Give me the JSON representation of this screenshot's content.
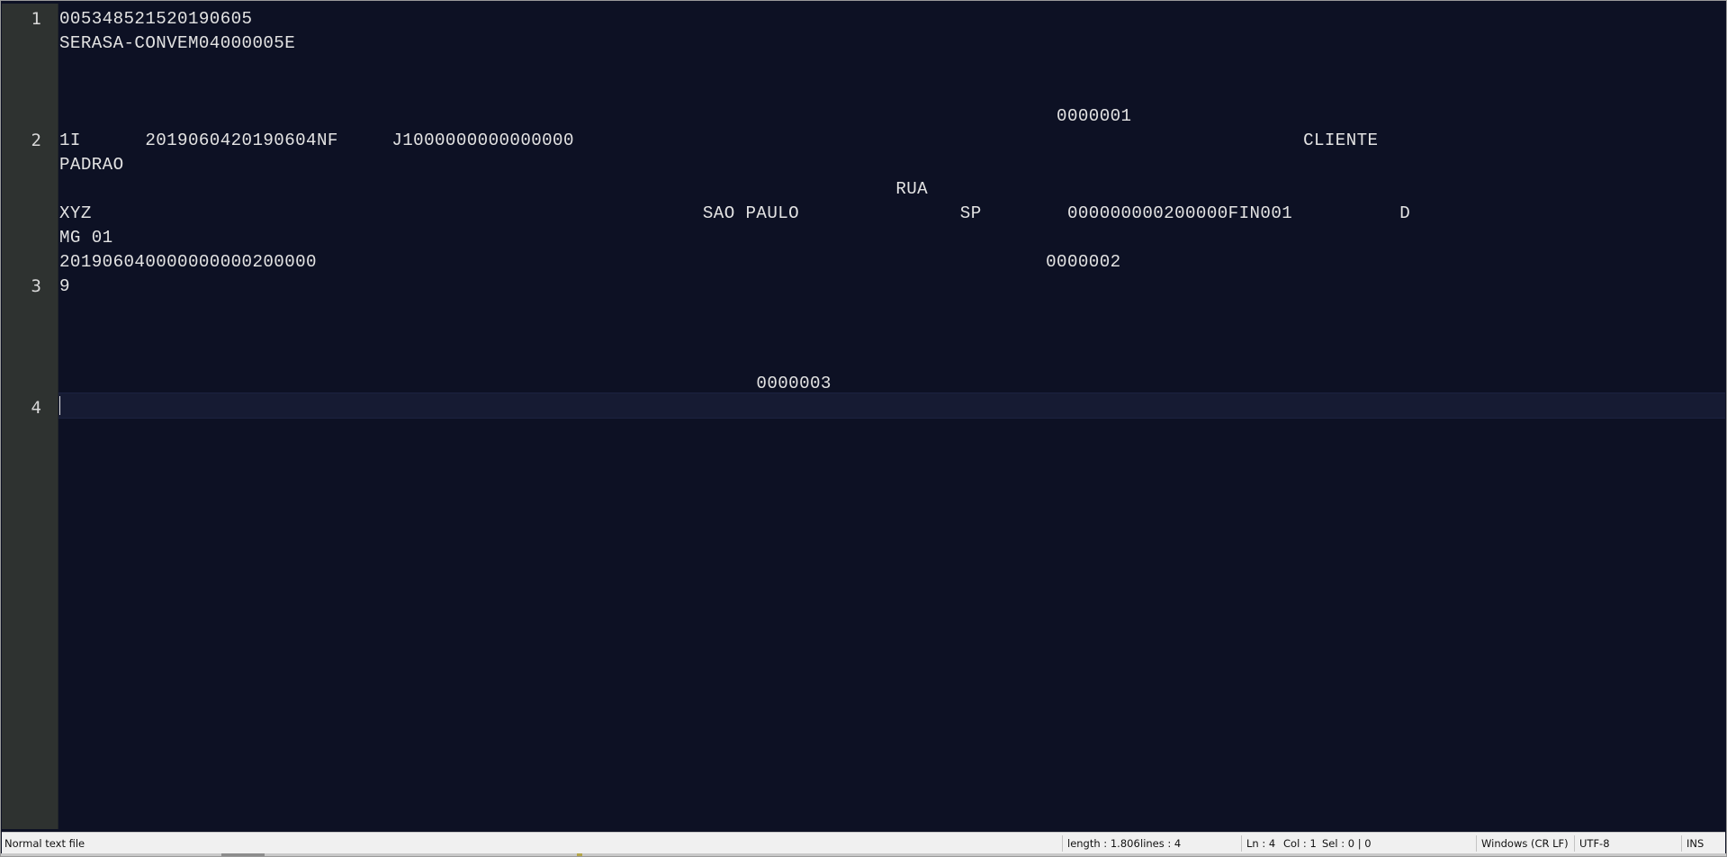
{
  "editor": {
    "line_numbers": [
      "1",
      "2",
      "3",
      "4"
    ],
    "rows": [
      "005348521520190605",
      "SERASA-CONVEM04000005E",
      "",
      "",
      "                                                                                             0000001",
      "1I      2019060420190604NF     J1000000000000000                                                                    CLIENTE",
      "PADRAO",
      "                                                                              RUA",
      "XYZ                                                         SAO PAULO               SP        000000000200000FIN001          D",
      "MG 01",
      "201906040000000000200000                                                                    0000002",
      "9",
      "",
      "",
      "",
      "                                                                 0000003",
      ""
    ]
  },
  "status": {
    "file_type": "Normal text file",
    "length": "length : 1.806",
    "lines": "lines : 4",
    "ln": "Ln : 4",
    "col": "Col : 1",
    "sel": "Sel : 0 | 0",
    "eol": "Windows (CR LF)",
    "encoding": "UTF-8",
    "mode": "INS"
  }
}
